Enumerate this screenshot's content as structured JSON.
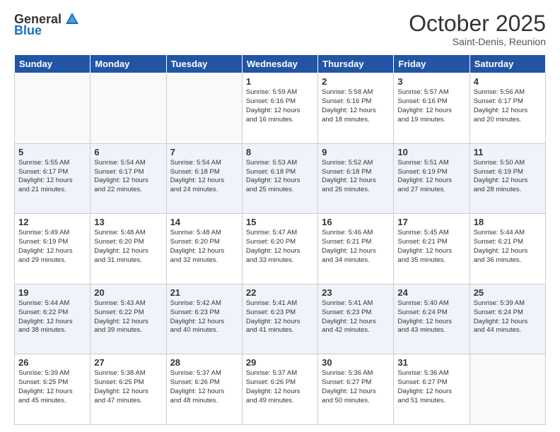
{
  "header": {
    "logo_general": "General",
    "logo_blue": "Blue",
    "month": "October 2025",
    "location": "Saint-Denis, Reunion"
  },
  "weekdays": [
    "Sunday",
    "Monday",
    "Tuesday",
    "Wednesday",
    "Thursday",
    "Friday",
    "Saturday"
  ],
  "weeks": [
    [
      {
        "day": "",
        "info": ""
      },
      {
        "day": "",
        "info": ""
      },
      {
        "day": "",
        "info": ""
      },
      {
        "day": "1",
        "info": "Sunrise: 5:59 AM\nSunset: 6:16 PM\nDaylight: 12 hours\nand 16 minutes."
      },
      {
        "day": "2",
        "info": "Sunrise: 5:58 AM\nSunset: 6:16 PM\nDaylight: 12 hours\nand 18 minutes."
      },
      {
        "day": "3",
        "info": "Sunrise: 5:57 AM\nSunset: 6:16 PM\nDaylight: 12 hours\nand 19 minutes."
      },
      {
        "day": "4",
        "info": "Sunrise: 5:56 AM\nSunset: 6:17 PM\nDaylight: 12 hours\nand 20 minutes."
      }
    ],
    [
      {
        "day": "5",
        "info": "Sunrise: 5:55 AM\nSunset: 6:17 PM\nDaylight: 12 hours\nand 21 minutes."
      },
      {
        "day": "6",
        "info": "Sunrise: 5:54 AM\nSunset: 6:17 PM\nDaylight: 12 hours\nand 22 minutes."
      },
      {
        "day": "7",
        "info": "Sunrise: 5:54 AM\nSunset: 6:18 PM\nDaylight: 12 hours\nand 24 minutes."
      },
      {
        "day": "8",
        "info": "Sunrise: 5:53 AM\nSunset: 6:18 PM\nDaylight: 12 hours\nand 25 minutes."
      },
      {
        "day": "9",
        "info": "Sunrise: 5:52 AM\nSunset: 6:18 PM\nDaylight: 12 hours\nand 26 minutes."
      },
      {
        "day": "10",
        "info": "Sunrise: 5:51 AM\nSunset: 6:19 PM\nDaylight: 12 hours\nand 27 minutes."
      },
      {
        "day": "11",
        "info": "Sunrise: 5:50 AM\nSunset: 6:19 PM\nDaylight: 12 hours\nand 28 minutes."
      }
    ],
    [
      {
        "day": "12",
        "info": "Sunrise: 5:49 AM\nSunset: 6:19 PM\nDaylight: 12 hours\nand 29 minutes."
      },
      {
        "day": "13",
        "info": "Sunrise: 5:48 AM\nSunset: 6:20 PM\nDaylight: 12 hours\nand 31 minutes."
      },
      {
        "day": "14",
        "info": "Sunrise: 5:48 AM\nSunset: 6:20 PM\nDaylight: 12 hours\nand 32 minutes."
      },
      {
        "day": "15",
        "info": "Sunrise: 5:47 AM\nSunset: 6:20 PM\nDaylight: 12 hours\nand 33 minutes."
      },
      {
        "day": "16",
        "info": "Sunrise: 5:46 AM\nSunset: 6:21 PM\nDaylight: 12 hours\nand 34 minutes."
      },
      {
        "day": "17",
        "info": "Sunrise: 5:45 AM\nSunset: 6:21 PM\nDaylight: 12 hours\nand 35 minutes."
      },
      {
        "day": "18",
        "info": "Sunrise: 5:44 AM\nSunset: 6:21 PM\nDaylight: 12 hours\nand 36 minutes."
      }
    ],
    [
      {
        "day": "19",
        "info": "Sunrise: 5:44 AM\nSunset: 6:22 PM\nDaylight: 12 hours\nand 38 minutes."
      },
      {
        "day": "20",
        "info": "Sunrise: 5:43 AM\nSunset: 6:22 PM\nDaylight: 12 hours\nand 39 minutes."
      },
      {
        "day": "21",
        "info": "Sunrise: 5:42 AM\nSunset: 6:23 PM\nDaylight: 12 hours\nand 40 minutes."
      },
      {
        "day": "22",
        "info": "Sunrise: 5:41 AM\nSunset: 6:23 PM\nDaylight: 12 hours\nand 41 minutes."
      },
      {
        "day": "23",
        "info": "Sunrise: 5:41 AM\nSunset: 6:23 PM\nDaylight: 12 hours\nand 42 minutes."
      },
      {
        "day": "24",
        "info": "Sunrise: 5:40 AM\nSunset: 6:24 PM\nDaylight: 12 hours\nand 43 minutes."
      },
      {
        "day": "25",
        "info": "Sunrise: 5:39 AM\nSunset: 6:24 PM\nDaylight: 12 hours\nand 44 minutes."
      }
    ],
    [
      {
        "day": "26",
        "info": "Sunrise: 5:39 AM\nSunset: 6:25 PM\nDaylight: 12 hours\nand 45 minutes."
      },
      {
        "day": "27",
        "info": "Sunrise: 5:38 AM\nSunset: 6:25 PM\nDaylight: 12 hours\nand 47 minutes."
      },
      {
        "day": "28",
        "info": "Sunrise: 5:37 AM\nSunset: 6:26 PM\nDaylight: 12 hours\nand 48 minutes."
      },
      {
        "day": "29",
        "info": "Sunrise: 5:37 AM\nSunset: 6:26 PM\nDaylight: 12 hours\nand 49 minutes."
      },
      {
        "day": "30",
        "info": "Sunrise: 5:36 AM\nSunset: 6:27 PM\nDaylight: 12 hours\nand 50 minutes."
      },
      {
        "day": "31",
        "info": "Sunrise: 5:36 AM\nSunset: 6:27 PM\nDaylight: 12 hours\nand 51 minutes."
      },
      {
        "day": "",
        "info": ""
      }
    ]
  ]
}
